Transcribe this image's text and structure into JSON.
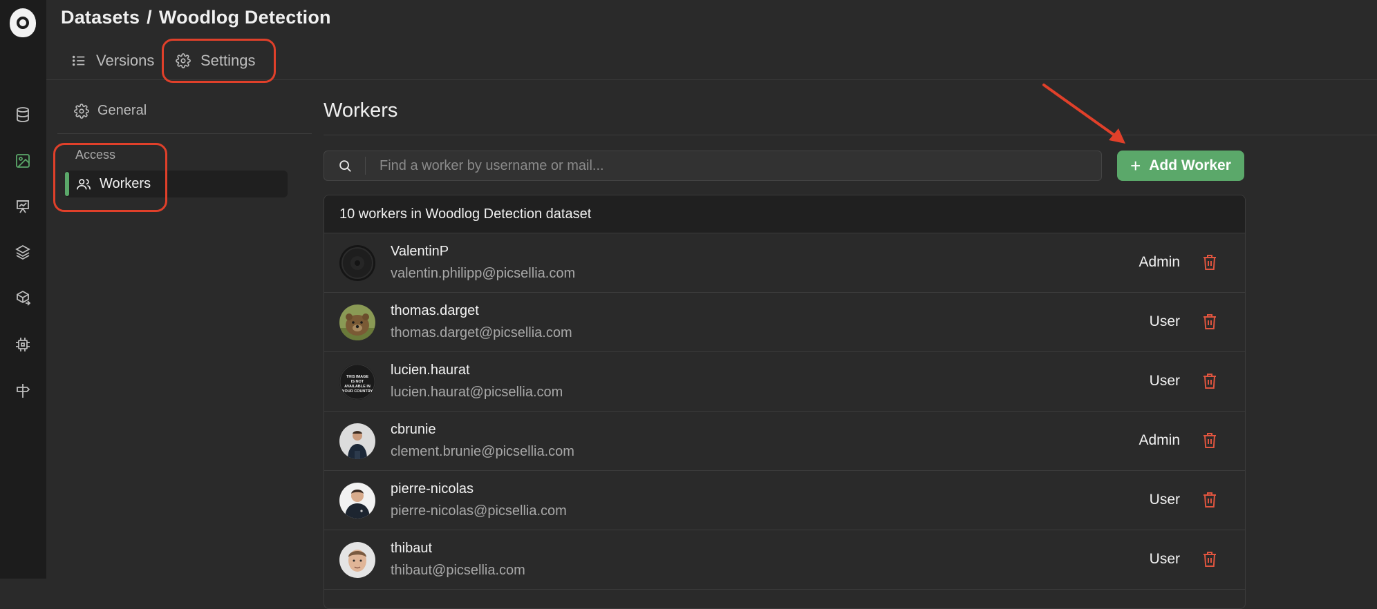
{
  "header": {
    "breadcrumb_root": "Datasets",
    "breadcrumb_sep": "/",
    "breadcrumb_current": "Woodlog Detection"
  },
  "tabs": [
    {
      "label": "Versions",
      "icon": "list-icon"
    },
    {
      "label": "Settings",
      "icon": "gear-icon"
    }
  ],
  "rail": {
    "icons": [
      "datasets-icon",
      "images-icon",
      "experiments-icon",
      "layers-icon",
      "deployments-icon",
      "processing-icon",
      "signpost-icon"
    ],
    "active_color": "#5ba86a"
  },
  "subnav": {
    "general_label": "General",
    "section_label": "Access",
    "workers_label": "Workers"
  },
  "main": {
    "title": "Workers",
    "search_placeholder": "Find a worker by username or mail...",
    "add_button_label": "Add Worker",
    "table_summary": "10 workers in Woodlog Detection dataset"
  },
  "workers": [
    {
      "username": "ValentinP",
      "email": "valentin.philipp@picsellia.com",
      "role": "Admin"
    },
    {
      "username": "thomas.darget",
      "email": "thomas.darget@picsellia.com",
      "role": "User"
    },
    {
      "username": "lucien.haurat",
      "email": "lucien.haurat@picsellia.com",
      "role": "User",
      "avatar_text": "THIS IMAGE IS NOT AVAILABLE IN YOUR COUNTRY"
    },
    {
      "username": "cbrunie",
      "email": "clement.brunie@picsellia.com",
      "role": "Admin"
    },
    {
      "username": "pierre-nicolas",
      "email": "pierre-nicolas@picsellia.com",
      "role": "User"
    },
    {
      "username": "thibaut",
      "email": "thibaut@picsellia.com",
      "role": "User"
    }
  ],
  "colors": {
    "accent": "#5ba86a",
    "annotation": "#e0402a",
    "delete": "#e0553f"
  }
}
